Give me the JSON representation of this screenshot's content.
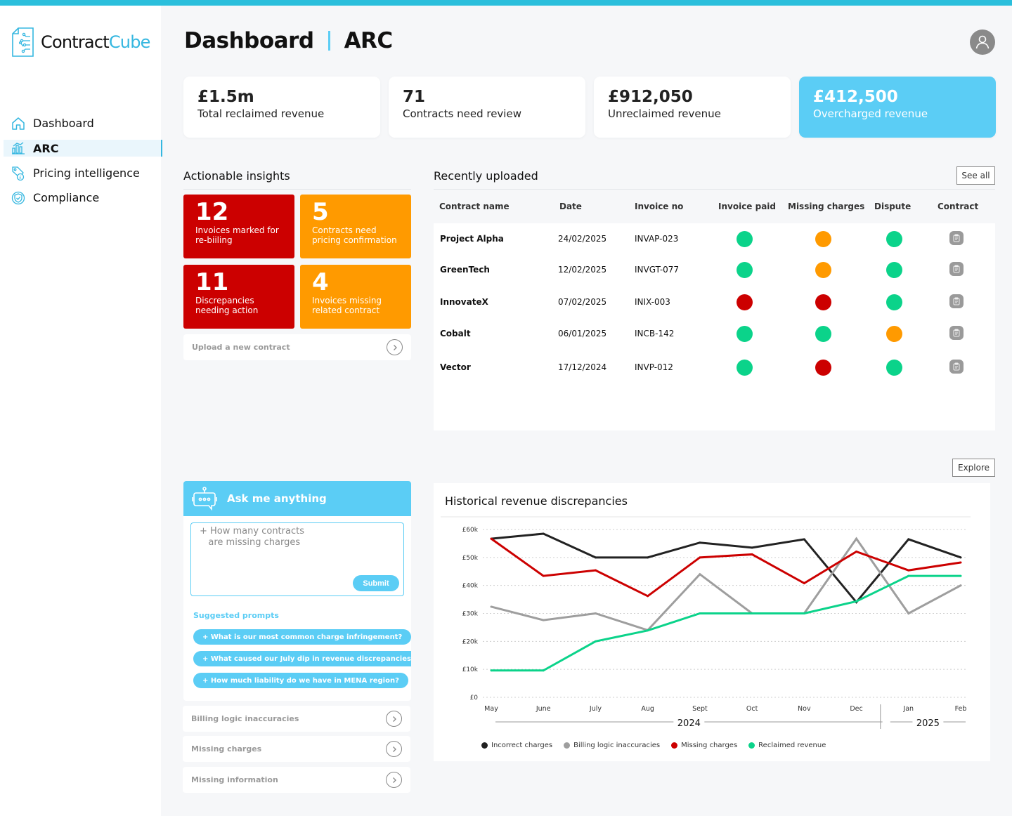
{
  "brand": {
    "name_part1": "Contract",
    "name_part2": "Cube"
  },
  "sidebar": {
    "items": [
      {
        "label": "Dashboard",
        "icon": "home-icon",
        "active": false
      },
      {
        "label": "ARC",
        "icon": "chart-bar-icon",
        "active": true
      },
      {
        "label": "Pricing intelligence",
        "icon": "price-tag-icon",
        "active": false
      },
      {
        "label": "Compliance",
        "icon": "shield-check-icon",
        "active": false
      }
    ]
  },
  "header": {
    "title": "Dashboard",
    "subtitle": "ARC",
    "avatar_icon": "user-icon"
  },
  "kpis": [
    {
      "value": "£1.5m",
      "label": "Total reclaimed revenue"
    },
    {
      "value": "71",
      "label": "Contracts need review"
    },
    {
      "value": "£912,050",
      "label": "Unreclaimed  revenue"
    },
    {
      "value": "£412,500",
      "label": "Overcharged revenue",
      "highlight": true
    }
  ],
  "insights": {
    "title": "Actionable insights",
    "tiles": [
      {
        "number": "12",
        "text": "Invoices marked for re-biiling",
        "color": "#cc0000"
      },
      {
        "number": "5",
        "text": "Contracts need pricing confirmation",
        "color": "#ff9a00"
      },
      {
        "number": "11",
        "text": "Discrepancies needing action",
        "color": "#cc0000"
      },
      {
        "number": "4",
        "text": "Invoices missing related contract",
        "color": "#ff9a00"
      }
    ],
    "upload_label": "Upload a new contract"
  },
  "recent": {
    "title": "Recently uploaded",
    "see_all": "See all",
    "columns": [
      "Contract name",
      "Date",
      "Invoice no",
      "Invoice paid",
      "Missing charges",
      "Dispute",
      "Contract"
    ],
    "rows": [
      {
        "name": "Project Alpha",
        "date": "24/02/2025",
        "invoice": "INVAP-023",
        "paid": "green",
        "missing": "orange",
        "dispute": "green"
      },
      {
        "name": "GreenTech",
        "date": "12/02/2025",
        "invoice": "INVGT-077",
        "paid": "green",
        "missing": "orange",
        "dispute": "green"
      },
      {
        "name": "InnovateX",
        "date": "07/02/2025",
        "invoice": "INIX-003",
        "paid": "red",
        "missing": "red",
        "dispute": "green"
      },
      {
        "name": "Cobalt",
        "date": "06/01/2025",
        "invoice": "INCB-142",
        "paid": "green",
        "missing": "green",
        "dispute": "orange"
      },
      {
        "name": "Vector",
        "date": "17/12/2024",
        "invoice": "INVP-012",
        "paid": "green",
        "missing": "red",
        "dispute": "green"
      }
    ],
    "status_colors": {
      "green": "#0bd38a",
      "orange": "#ff9a00",
      "red": "#cc0000"
    }
  },
  "ask": {
    "title": "Ask me anything",
    "input_value": "+ How many contracts\n   are missing charges",
    "submit": "Submit",
    "suggested_title": "Suggested prompts",
    "prompts": [
      "+ What is our most common charge infringement?",
      "+ What caused our July dip in revenue discrepancies?",
      "+ How much liability do we have in MENA region?"
    ]
  },
  "categories": [
    "Billing logic inaccuracies",
    "Missing charges",
    "Missing information"
  ],
  "explore": "Explore",
  "chart_data": {
    "type": "line",
    "title": "Historical revenue discrepancies",
    "x": [
      "May",
      "June",
      "July",
      "Aug",
      "Sept",
      "Oct",
      "Nov",
      "Dec",
      "Jan",
      "Feb"
    ],
    "year_groups": [
      {
        "label": "2024",
        "months": 8
      },
      {
        "label": "2025",
        "months": 2
      }
    ],
    "yticks": [
      "£0",
      "£10k",
      "£20k",
      "£30k",
      "£40k",
      "£50k",
      "£60k"
    ],
    "ylim": [
      0,
      60000
    ],
    "grid": true,
    "legend_position": "bottom",
    "series": [
      {
        "name": "Incorrect charges",
        "color": "#222222",
        "values": [
          56700,
          58500,
          50000,
          50000,
          55300,
          53500,
          56500,
          34000,
          56500,
          50000
        ]
      },
      {
        "name": "Billing logic inaccuracies",
        "color": "#9e9e9e",
        "values": [
          32400,
          27600,
          30000,
          24000,
          44000,
          30000,
          30000,
          56700,
          30000,
          40000
        ]
      },
      {
        "name": "Missing charges",
        "color": "#cc0000",
        "values": [
          56700,
          43400,
          45400,
          36200,
          50000,
          51100,
          40800,
          52100,
          45400,
          48200
        ]
      },
      {
        "name": "Reclaimed revenue",
        "color": "#0bd38a",
        "values": [
          9600,
          9600,
          20000,
          23900,
          30000,
          30000,
          30000,
          34300,
          43400,
          43400
        ]
      }
    ]
  }
}
